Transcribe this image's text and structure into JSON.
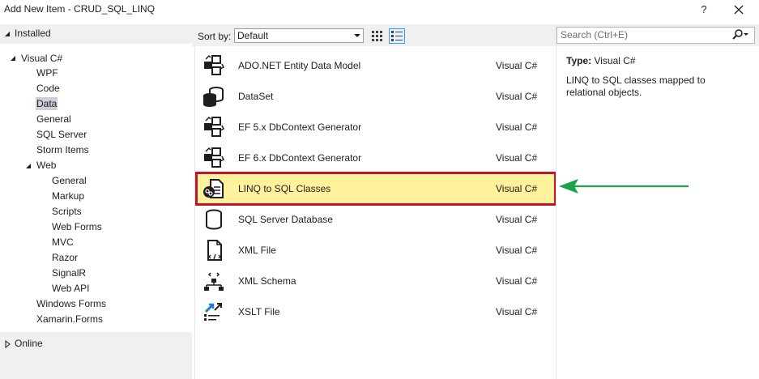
{
  "window": {
    "title": "Add New Item - CRUD_SQL_LINQ",
    "help_label": "?"
  },
  "tree": {
    "installed_label": "Installed",
    "visual_csharp_label": "Visual C#",
    "items": [
      {
        "label": "WPF"
      },
      {
        "label": "Code"
      },
      {
        "label": "Data"
      },
      {
        "label": "General"
      },
      {
        "label": "SQL Server"
      },
      {
        "label": "Storm Items"
      }
    ],
    "web_label": "Web",
    "web_items": [
      {
        "label": "General"
      },
      {
        "label": "Markup"
      },
      {
        "label": "Scripts"
      },
      {
        "label": "Web Forms"
      },
      {
        "label": "MVC"
      },
      {
        "label": "Razor"
      },
      {
        "label": "SignalR"
      },
      {
        "label": "Web API"
      }
    ],
    "after_items": [
      {
        "label": "Windows Forms"
      },
      {
        "label": "Xamarin.Forms"
      }
    ],
    "online_label": "Online"
  },
  "toolbar": {
    "sort_by_label": "Sort by:",
    "sort_value": "Default"
  },
  "search": {
    "placeholder": "Search (Ctrl+E)"
  },
  "templates": [
    {
      "name": "ADO.NET Entity Data Model",
      "language": "Visual C#",
      "icon": "entity-model-icon"
    },
    {
      "name": "DataSet",
      "language": "Visual C#",
      "icon": "dataset-icon"
    },
    {
      "name": "EF 5.x DbContext Generator",
      "language": "Visual C#",
      "icon": "ef-generator-icon"
    },
    {
      "name": "EF 6.x DbContext Generator",
      "language": "Visual C#",
      "icon": "ef-generator-icon"
    },
    {
      "name": "LINQ to SQL Classes",
      "language": "Visual C#",
      "icon": "linq-to-sql-icon"
    },
    {
      "name": "SQL Server Database",
      "language": "Visual C#",
      "icon": "database-icon"
    },
    {
      "name": "XML File",
      "language": "Visual C#",
      "icon": "xml-file-icon"
    },
    {
      "name": "XML Schema",
      "language": "Visual C#",
      "icon": "xml-schema-icon"
    },
    {
      "name": "XSLT File",
      "language": "Visual C#",
      "icon": "xslt-file-icon"
    }
  ],
  "details": {
    "type_label": "Type:",
    "type_value": "Visual C#",
    "description": "LINQ to SQL classes mapped to relational objects."
  },
  "colors": {
    "selected_item_bg": "#fff29d",
    "highlight_border": "#c0142b",
    "arrow": "#1aa34a",
    "tree_selected_bg": "#cccedb"
  }
}
